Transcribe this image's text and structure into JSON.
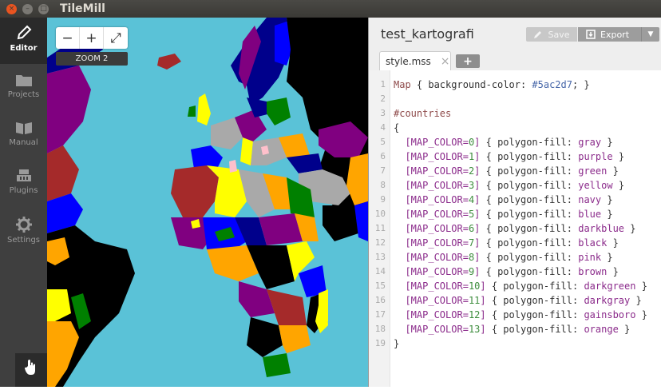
{
  "app": {
    "title": "TileMill"
  },
  "window_controls": {
    "close": "×",
    "minimize": "–",
    "maximize": "□"
  },
  "sidebar": {
    "items": [
      {
        "label": "Editor",
        "icon": "pencil-icon"
      },
      {
        "label": "Projects",
        "icon": "folder-icon"
      },
      {
        "label": "Manual",
        "icon": "book-icon"
      },
      {
        "label": "Plugins",
        "icon": "plugin-icon"
      },
      {
        "label": "Settings",
        "icon": "gear-icon"
      }
    ],
    "hand_tool": "hand-icon"
  },
  "map": {
    "background": "#5ac2d7",
    "zoom_in": "+",
    "zoom_out": "−",
    "fullscreen": "⤢",
    "zoom_label": "ZOOM 2"
  },
  "editor": {
    "project_name": "test_kartografi",
    "save_label": "Save",
    "export_label": "Export",
    "tab_label": "style.mss",
    "tab_close": "×",
    "add_tab": "+",
    "code_lines": [
      "Map { background-color: #5ac2d7; }",
      "",
      "#countries",
      "{",
      "  [MAP_COLOR=0] { polygon-fill: gray }",
      "  [MAP_COLOR=1] { polygon-fill: purple }",
      "  [MAP_COLOR=2] { polygon-fill: green }",
      "  [MAP_COLOR=3] { polygon-fill: yellow }",
      "  [MAP_COLOR=4] { polygon-fill: navy }",
      "  [MAP_COLOR=5] { polygon-fill: blue }",
      "  [MAP_COLOR=6] { polygon-fill: darkblue }",
      "  [MAP_COLOR=7] { polygon-fill: black }",
      "  [MAP_COLOR=8] { polygon-fill: pink }",
      "  [MAP_COLOR=9] { polygon-fill: brown }",
      "  [MAP_COLOR=10] { polygon-fill: darkgreen }",
      "  [MAP_COLOR=11] { polygon-fill: darkgray }",
      "  [MAP_COLOR=12] { polygon-fill: gainsboro }",
      "  [MAP_COLOR=13] { polygon-fill: orange }",
      "}"
    ]
  }
}
